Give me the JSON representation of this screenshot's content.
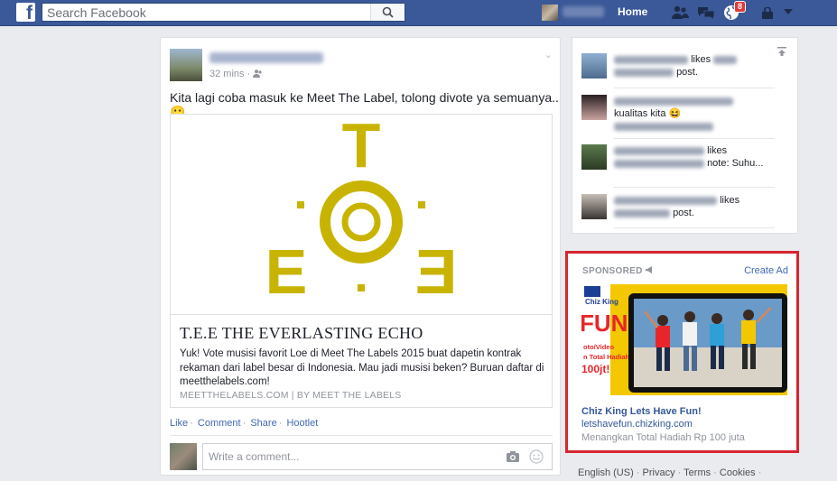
{
  "topbar": {
    "logo_letter": "f",
    "search_placeholder": "Search Facebook",
    "home_label": "Home",
    "notification_count": "8",
    "bg_color": "#3b5998"
  },
  "post": {
    "time": "32 mins ·",
    "text": "Kita lagi coba masuk ke Meet The Label, tolong divote ya semuanya.. 🙂",
    "logo": {
      "top_letter": "T",
      "left_letter": "E",
      "right_letter": "E",
      "color": "#c8b400"
    },
    "link": {
      "title": "T.E.E THE EVERLASTING ECHO",
      "description": "Yuk! Vote musisi favorit Loe di Meet The Labels 2015 buat dapetin kontrak rekaman dari label besar di Indonesia. Mau jadi musisi beken? Buruan daftar di meetthelabels.com!",
      "source": "MEETTHELABELS.COM | BY MEET THE LABELS"
    },
    "actions": [
      "Like",
      "Comment",
      "Share",
      "Hootlet"
    ],
    "comment_placeholder": "Write a comment..."
  },
  "ticker": {
    "items": [
      {
        "pre": "",
        "text_a": "likes",
        "text_b": "post."
      },
      {
        "pre": "",
        "text_a": "kualitas kita 😆",
        "text_b": ""
      },
      {
        "pre": "",
        "text_a": "likes",
        "text_b": "note: Suhu..."
      },
      {
        "pre": "",
        "text_a": "likes",
        "text_b": "post."
      }
    ]
  },
  "ad": {
    "sponsored_label": "SPONSORED",
    "create_label": "Create Ad",
    "brand": "Chiz King",
    "img_fun": "FUN",
    "img_line1": "oto/Video",
    "img_line2": "n Total Hadiah",
    "img_line3": "100jt!",
    "title": "Chiz King Lets Have Fun!",
    "url": "letshavefun.chizking.com",
    "desc": "Menangkan Total Hadiah Rp 100 juta",
    "highlight_color": "#d7252f"
  },
  "footer": {
    "links": [
      "English (US)",
      "Privacy",
      "Terms",
      "Cookies"
    ]
  }
}
